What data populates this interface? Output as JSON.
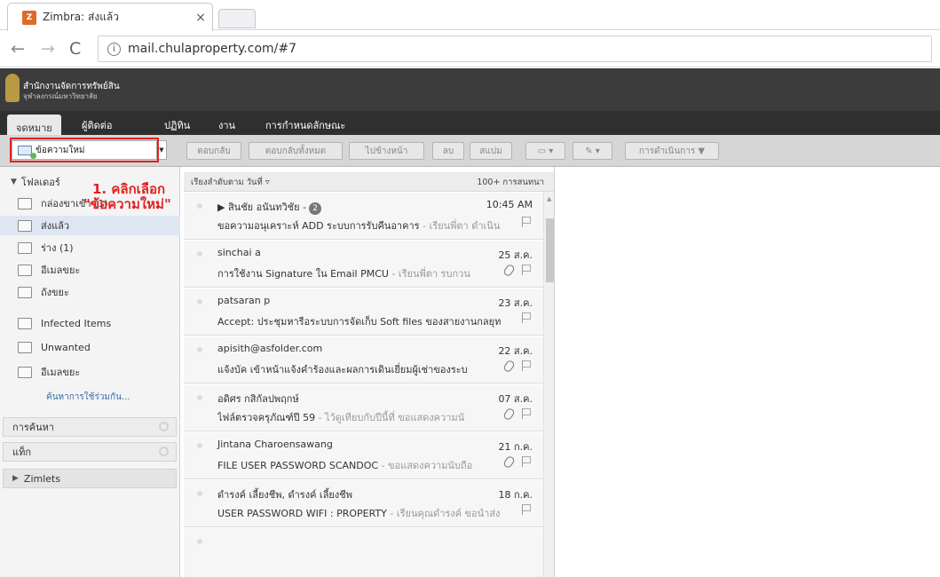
{
  "browser": {
    "tab_title": "Zimbra: ส่งแล้ว",
    "tab_icon": "zimbra-icon",
    "url": "mail.chulaproperty.com/#7"
  },
  "header": {
    "logo_line1": "สำนักงานจัดการทรัพย์สิน",
    "logo_line2": "จุฬาลงกรณ์มหาวิทยาลัย"
  },
  "app_tabs": [
    "จดหมาย",
    "ผู้ติดต่อ",
    "ปฏิทิน",
    "งาน",
    "การกำหนดลักษณะ"
  ],
  "toolbar": {
    "new_message": "ข้อความใหม่",
    "reply": "ตอบกลับ",
    "reply_all": "ตอบกลับทั้งหมด",
    "forward": "ไปข้างหน้า",
    "delete": "ลบ",
    "spam": "สแปม",
    "actions": "การดำเนินการ ▼"
  },
  "sidebar": {
    "folders_title": "โฟลเดอร์",
    "folders": [
      {
        "label": "กล่องขาเข้า (1)",
        "icon": "inbox-icon"
      },
      {
        "label": "ส่งแล้ว",
        "icon": "sent-icon"
      },
      {
        "label": "ร่าง (1)",
        "icon": "drafts-icon"
      },
      {
        "label": "อีเมลขยะ",
        "icon": "junk-icon"
      },
      {
        "label": "ถังขยะ",
        "icon": "trash-icon"
      },
      {
        "label": "Infected Items",
        "icon": "folder-icon"
      },
      {
        "label": "Unwanted",
        "icon": "folder-icon"
      },
      {
        "label": "อีเมลขยะ",
        "icon": "folder-icon"
      }
    ],
    "share_link": "ค้นหาการใช้ร่วมกัน...",
    "search_panel": "การค้นหา",
    "tags_panel": "แท็ก",
    "zimlets_panel": "Zimlets"
  },
  "annotation": {
    "line1": "1. คลิกเลือก",
    "line2": "\"ข้อความใหม่\""
  },
  "message_list": {
    "sort_label": "เรียงลำดับตาม วันที่",
    "count_label": "100+ การสนทนา",
    "rows": [
      {
        "sender": "▶ สินชัย อนันทวิชัย -",
        "badge": "2",
        "date": "10:45 AM",
        "subject": "ขอความอนุเคราะห์ ADD ระบบการรับคืนอาคาร",
        "preview": " - เรียนพี่ตา ดำเนิน"
      },
      {
        "sender": "sinchai a",
        "date": "25 ส.ค.",
        "subject": "การใช้งาน Signature ใน Email PMCU",
        "preview": " - เรียนพี่ตา รบกวน"
      },
      {
        "sender": "patsaran p",
        "date": "23 ส.ค.",
        "subject": "Accept: ประชุมหารือระบบการจัดเก็บ Soft files ของสายงานกลยุท",
        "preview": ""
      },
      {
        "sender": "apisith@asfolder.com",
        "date": "22 ส.ค.",
        "subject": "แจ้งบัค เข้าหน้าแจ้งคำร้องและผลการเดินเยี่ยมผู้เช่าของระบ",
        "preview": ""
      },
      {
        "sender": "อดิศร กสิกัลปพฤกษ์",
        "date": "07 ส.ค.",
        "subject": "ไฟล์ตรวจครุภัณฑ์ปี 59",
        "preview": " - ไว้ดูเทียบกับปีนี้ที่ ขอแสดงความนั"
      },
      {
        "sender": "Jintana Charoensawang",
        "date": "21 ก.ค.",
        "subject": "FILE USER PASSWORD SCANDOC",
        "preview": " - ขอแสดงความนับถือ"
      },
      {
        "sender": "ดำรงค์ เลี้ยงชีพ, ดำรงค์ เลี้ยงชีพ",
        "date": "18 ก.ค.",
        "subject": "USER PASSWORD WIFI : PROPERTY",
        "preview": " - เรียนคุณดำรงค์ ขอนำส่ง"
      }
    ]
  }
}
